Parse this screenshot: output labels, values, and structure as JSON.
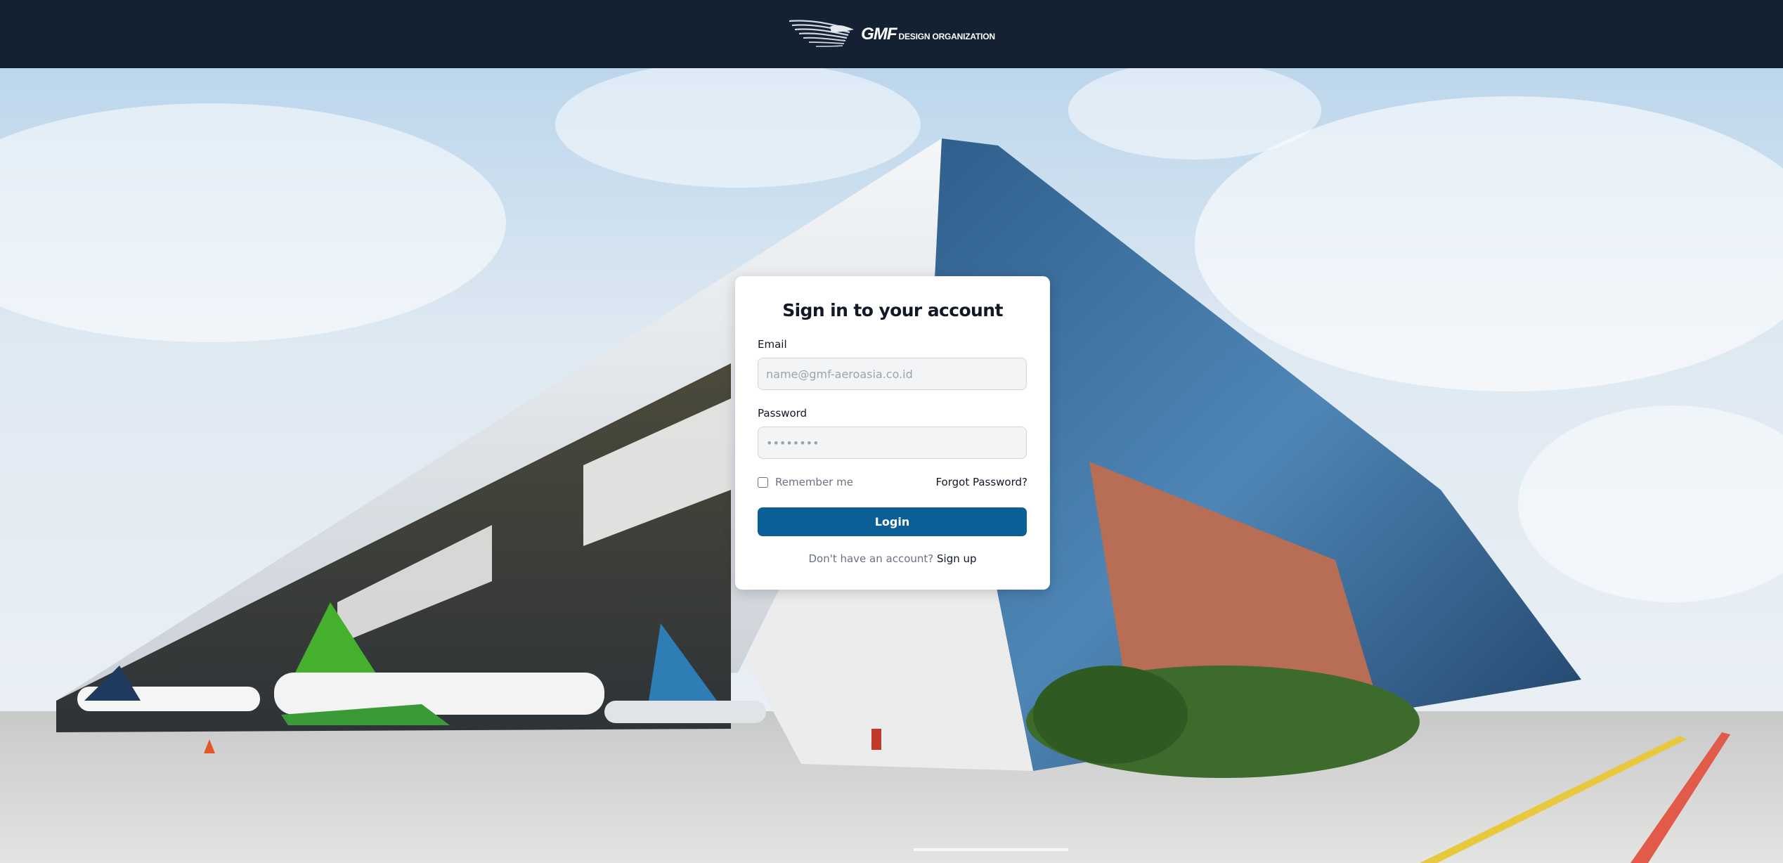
{
  "header": {
    "logo_main": "GMF",
    "logo_sub": "DESIGN ORGANIZATION"
  },
  "login_card": {
    "title": "Sign in to your account",
    "email": {
      "label": "Email",
      "placeholder": "name@gmf-aeroasia.co.id",
      "value": ""
    },
    "password": {
      "label": "Password",
      "placeholder": "••••••••",
      "value": ""
    },
    "remember_label": "Remember me",
    "remember_checked": false,
    "forgot_label": "Forgot Password?",
    "login_label": "Login",
    "signup_prompt": "Don't have an account?",
    "signup_label": "Sign up"
  },
  "colors": {
    "header_bg": "#132132",
    "primary_button": "#0c5f96",
    "card_bg": "#ffffff"
  },
  "icons": {
    "logo": "gmf-wing-logo-icon",
    "checkbox": "checkbox-icon"
  }
}
